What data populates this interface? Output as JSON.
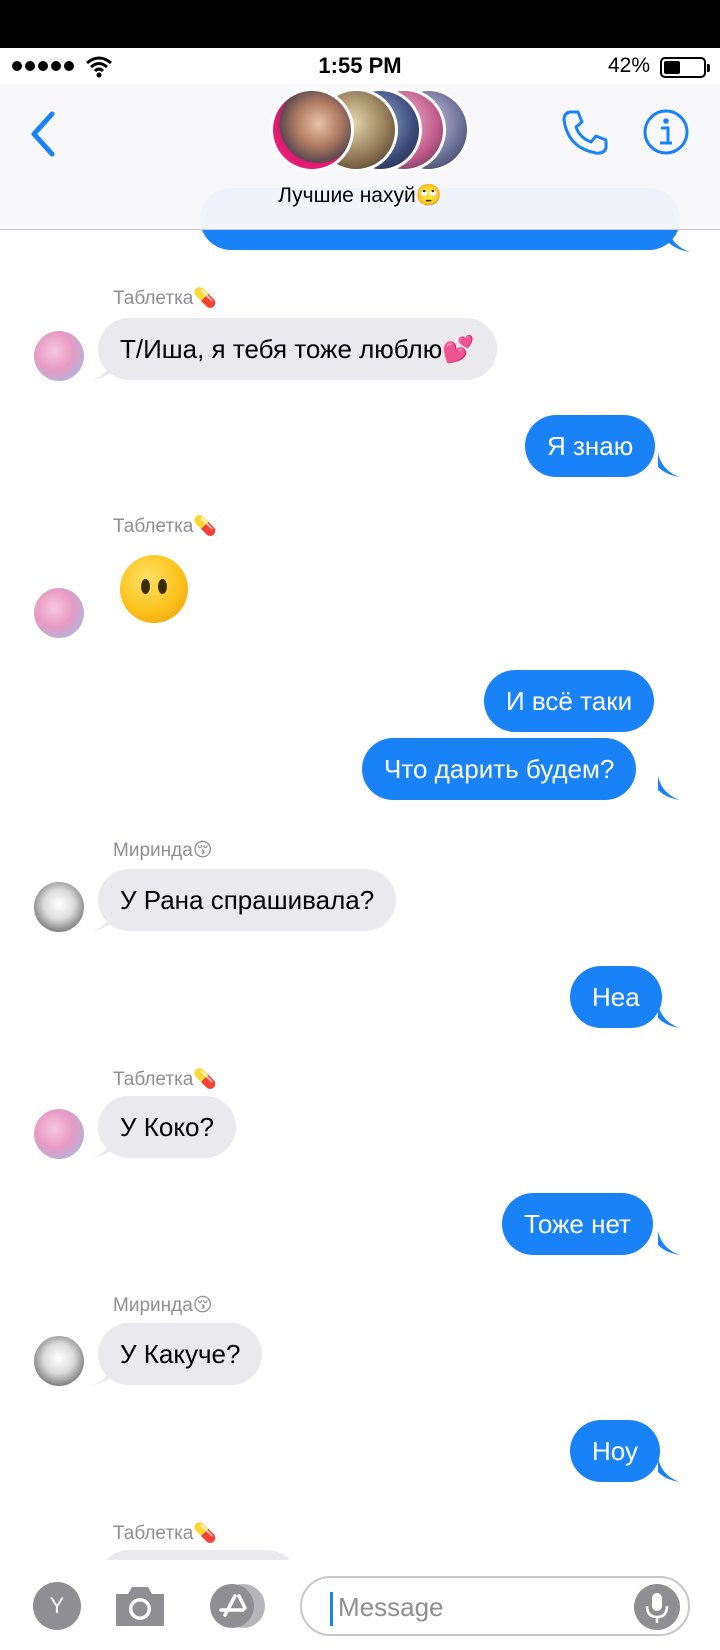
{
  "status": {
    "time": "1:55 PM",
    "battery_percent": "42%",
    "battery_level": 0.42
  },
  "header": {
    "group_name": "Лучшие нахуй🙄",
    "icons": {
      "back": "chevron-left-icon",
      "call": "phone-icon",
      "info": "info-icon"
    }
  },
  "conversation": {
    "partial_top_message": "…",
    "messages": [
      {
        "side": "in",
        "sender": "Таблетка💊",
        "text": "Т/Иша, я тебя тоже люблю💕"
      },
      {
        "side": "out",
        "text": "Я знаю"
      },
      {
        "side": "in",
        "sender": "Таблетка💊",
        "emoji": "face-without-mouth"
      },
      {
        "side": "out",
        "text": "И всё таки"
      },
      {
        "side": "out",
        "text": "Что дарить будем?"
      },
      {
        "side": "in",
        "sender": "Миринда😚",
        "text": "У Рана спрашивала?"
      },
      {
        "side": "out",
        "text": "Неа"
      },
      {
        "side": "in",
        "sender": "Таблетка💊",
        "text": "У Коко?"
      },
      {
        "side": "out",
        "text": "Тоже нет"
      },
      {
        "side": "in",
        "sender": "Миринда😚",
        "text": "У Какуче?"
      },
      {
        "side": "out",
        "text": "Ноу"
      },
      {
        "side": "in",
        "sender": "Таблетка💊",
        "text": ""
      }
    ]
  },
  "composer": {
    "app_button_label": "Y",
    "placeholder": "Message",
    "value": "",
    "icons": {
      "camera": "camera-icon",
      "appstore": "app-store-icon",
      "mic": "microphone-icon"
    }
  },
  "colors": {
    "outgoing_bubble": "#1a82f7",
    "incoming_bubble": "#e9e9ee",
    "accent": "#1a82f7"
  }
}
